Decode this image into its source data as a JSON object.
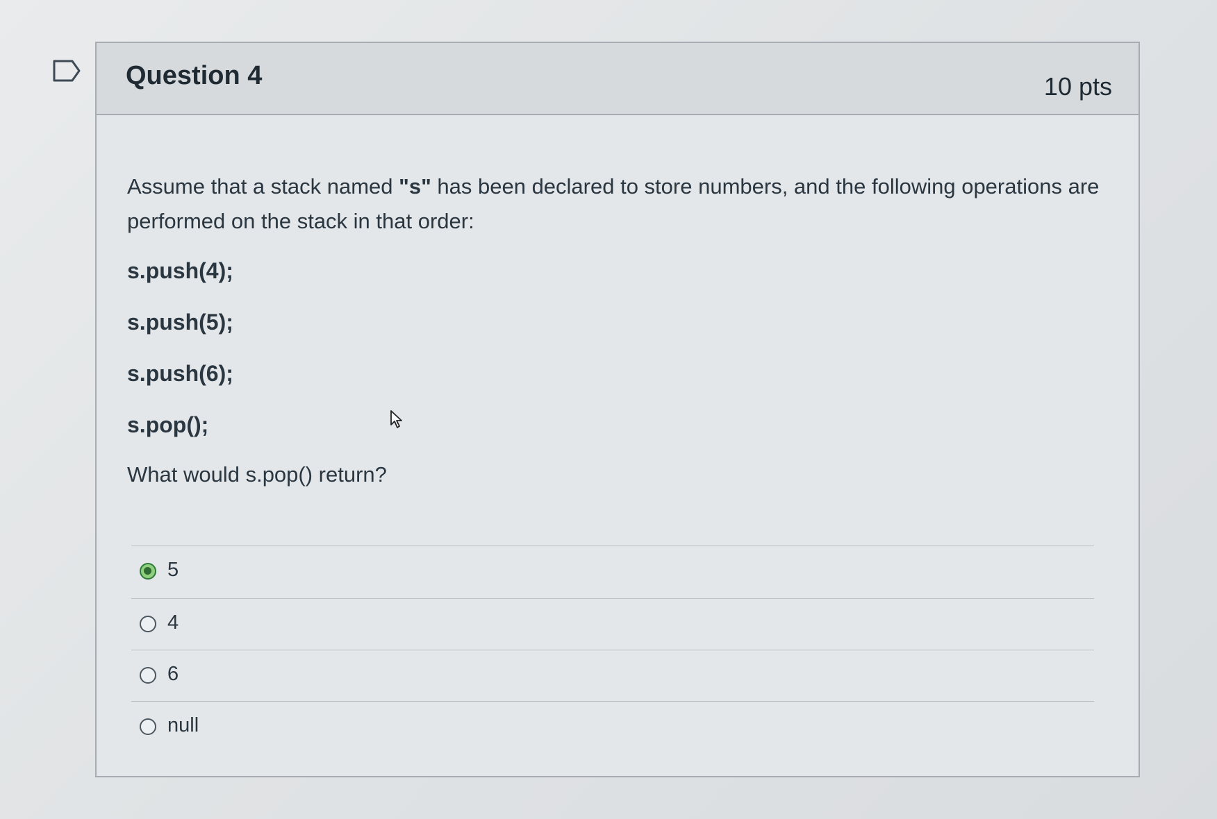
{
  "question": {
    "title": "Question 4",
    "points": "10 pts",
    "prompt_part1": "Assume that a stack named ",
    "prompt_bold": "\"s\"",
    "prompt_part2": " has been declared to store numbers, and the following operations are performed on the stack in that order:",
    "code_lines": [
      "s.push(4);",
      "s.push(5);",
      "s.push(6);",
      "s.pop();"
    ],
    "ask": "What would s.pop() return?"
  },
  "answers": [
    {
      "label": "5",
      "selected": true
    },
    {
      "label": "4",
      "selected": false
    },
    {
      "label": "6",
      "selected": false
    },
    {
      "label": "null",
      "selected": false
    }
  ],
  "colors": {
    "selected_radio": "#8fcf7d",
    "header_bg": "#d6dadd",
    "border": "#a6acb1"
  },
  "icons": {
    "bookmark": "bookmark-flag-icon",
    "cursor": "mouse-pointer-icon"
  }
}
